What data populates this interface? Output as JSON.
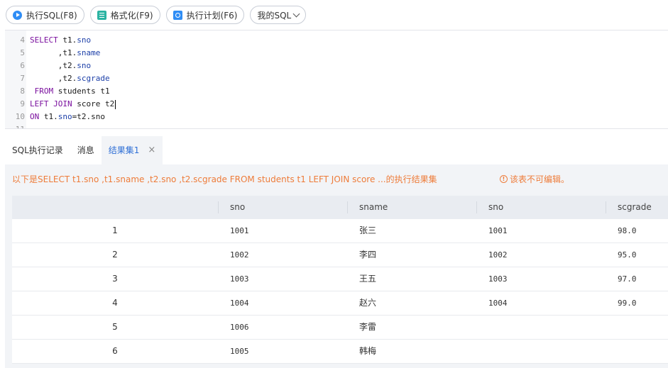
{
  "toolbar": {
    "run_label": "执行SQL(F8)",
    "format_label": "格式化(F9)",
    "plan_label": "执行计划(F6)",
    "mysql_label": "我的SQL"
  },
  "editor": {
    "lines": [
      {
        "num": "4",
        "a": "SELECT",
        "b": " t1.",
        "c": "sno",
        "d": ""
      },
      {
        "num": "5",
        "a": "",
        "b": "      ,t1.",
        "c": "sname",
        "d": ""
      },
      {
        "num": "6",
        "a": "",
        "b": "      ,t2.",
        "c": "sno",
        "d": ""
      },
      {
        "num": "7",
        "a": "",
        "b": "      ,t2.",
        "c": "scgrade",
        "d": ""
      },
      {
        "num": "8",
        "a": " FROM",
        "b": " students t1",
        "c": "",
        "d": ""
      },
      {
        "num": "9",
        "a": "LEFT JOIN",
        "b": " score t2",
        "c": "",
        "d": ""
      },
      {
        "num": "10",
        "a": "ON",
        "b": " t1.",
        "c": "sno",
        "d": "=t2.sno"
      },
      {
        "num": "11",
        "a": "",
        "b": "",
        "c": "",
        "d": ""
      }
    ]
  },
  "tabs": {
    "history": "SQL执行记录",
    "messages": "消息",
    "result": "结果集1",
    "close": "×"
  },
  "result": {
    "notice": "以下是SELECT t1.sno ,t1.sname ,t2.sno ,t2.scgrade FROM students t1 LEFT JOIN score ...的执行结果集",
    "readonly": "该表不可编辑。",
    "headers": [
      "",
      "sno",
      "sname",
      "sno",
      "scgrade"
    ],
    "rows": [
      [
        "1",
        "1001",
        "张三",
        "1001",
        "98.0"
      ],
      [
        "2",
        "1002",
        "李四",
        "1002",
        "95.0"
      ],
      [
        "3",
        "1003",
        "王五",
        "1003",
        "97.0"
      ],
      [
        "4",
        "1004",
        "赵六",
        "1004",
        "99.0"
      ],
      [
        "5",
        "1006",
        "李雷",
        "",
        ""
      ],
      [
        "6",
        "1005",
        "韩梅",
        "",
        ""
      ]
    ]
  }
}
